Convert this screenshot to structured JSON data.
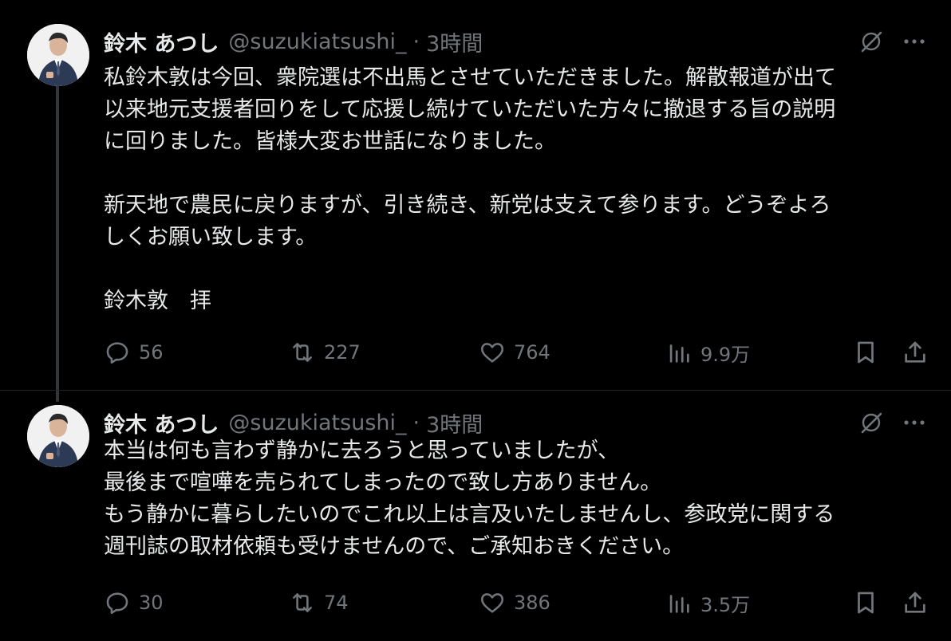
{
  "tweets": [
    {
      "author": {
        "display_name": "鈴木 あつし",
        "handle": "@suzukiatsushi_",
        "separator": "·",
        "time": "3時間"
      },
      "lines": [
        "私鈴木敦は今回、衆院選は不出馬とさせていただきました。解散報道が出て",
        "以来地元支援者回りをして応援し続けていただいた方々に撤退する旨の説明",
        "に回りました。皆様大変お世話になりました。",
        "",
        "新天地で農民に戻りますが、引き続き、新党は支えて参ります。どうぞよろ",
        "しくお願い致します。",
        "",
        "鈴木敦　拝"
      ],
      "stats": {
        "replies": "56",
        "reposts": "227",
        "likes": "764",
        "views": "9.9万"
      }
    },
    {
      "author": {
        "display_name": "鈴木 あつし",
        "handle": "@suzukiatsushi_",
        "separator": "·",
        "time": "3時間"
      },
      "lines": [
        "本当は何も言わず静かに去ろうと思っていましたが、",
        "最後まで喧嘩を売られてしまったので致し方ありません。",
        "もう静かに暮らしたいのでこれ以上は言及いたしませんし、参政党に関する",
        "週刊誌の取材依頼も受けませんので、ご承知おきください。"
      ],
      "stats": {
        "replies": "30",
        "reposts": "74",
        "likes": "386",
        "views": "3.5万"
      }
    }
  ],
  "icons": {
    "reply": "reply-icon",
    "repost": "repost-icon",
    "like": "heart-icon",
    "views": "views-icon",
    "bookmark": "bookmark-icon",
    "share": "share-icon",
    "grok": "grok-icon",
    "more": "more-icon"
  },
  "colors": {
    "background": "#000000",
    "text_primary": "#e7e9ea",
    "text_secondary": "#71767b",
    "thread_line": "#333639"
  }
}
